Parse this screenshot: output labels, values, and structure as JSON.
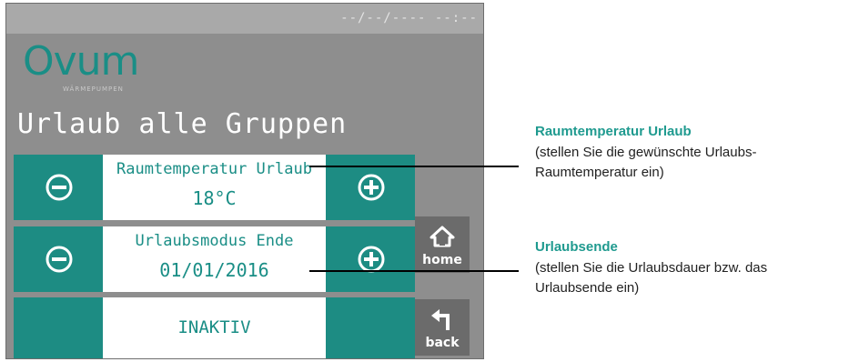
{
  "status": {
    "datetime": "--/--/---- --:--"
  },
  "logo": {
    "name": "Ovum",
    "tagline": "WÄRMEPUMPEN"
  },
  "screen": {
    "title": "Urlaub alle Gruppen"
  },
  "rows": [
    {
      "label": "Raumtemperatur Urlaub",
      "value": "18°C",
      "minus_icon": "minus-circle-icon",
      "plus_icon": "plus-circle-icon"
    },
    {
      "label": "Urlaubsmodus Ende",
      "value": "01/01/2016",
      "minus_icon": "minus-circle-icon",
      "plus_icon": "plus-circle-icon"
    },
    {
      "status": "INAKTIV"
    }
  ],
  "nav": {
    "home_label": "home",
    "back_label": "back"
  },
  "annotations": [
    {
      "title": "Raumtemperatur Urlaub",
      "description": "(stellen Sie die gewünschte Urlaubs-\nRaumtemperatur ein)"
    },
    {
      "title": "Urlaubsende",
      "description": "(stellen Sie die Urlaubsdauer bzw. das\nUrlaubsende ein)"
    }
  ],
  "colors": {
    "teal": "#1d8c83",
    "panel": "#8e8e8e",
    "nav_button": "#6b6b6b"
  }
}
